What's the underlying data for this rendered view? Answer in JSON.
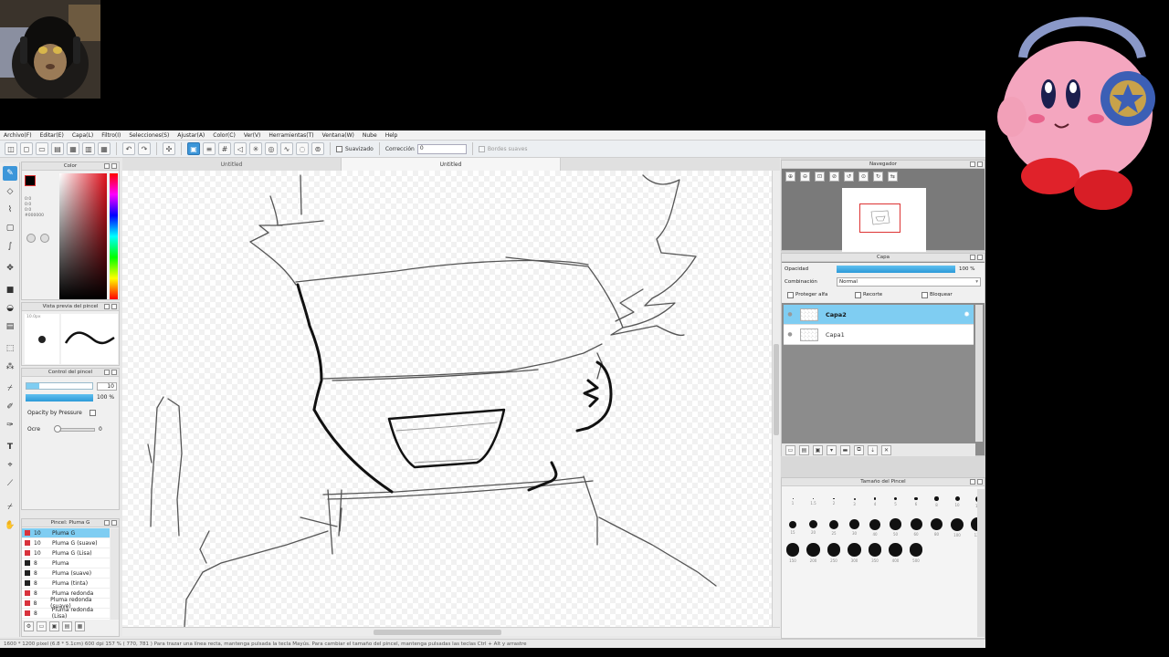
{
  "menu": [
    "Archivo(F)",
    "Editar(E)",
    "Capa(L)",
    "Filtro(I)",
    "Selecciones(S)",
    "Ajustar(A)",
    "Color(C)",
    "Ver(V)",
    "Herramientas(T)",
    "Ventana(W)",
    "Nube",
    "Help"
  ],
  "toolbar": {
    "smooth_label": "Suavizado",
    "correction_label": "Corrección",
    "correction_value": "0",
    "smooth_lines_label": "Bordes suaves"
  },
  "tabs": [
    "Untitled",
    "Untitled"
  ],
  "color_panel": {
    "title": "Color",
    "hex_value": "#000000",
    "rgb_values": [
      "0:0",
      "0:0",
      "0:0"
    ],
    "accent": "#3c96d9"
  },
  "brush_preview": {
    "title": "Vista previa del pincel",
    "size_text": "10.0px"
  },
  "brush_control": {
    "title": "Control del pincel",
    "size_value": "10",
    "opacity_value": "100 %",
    "opacity_pressure_label": "Opacity by Pressure",
    "blur_label": "Ocre",
    "blur_value": "0"
  },
  "brush_list": {
    "title": "Pincel: Pluma G",
    "items": [
      {
        "size": "10",
        "name": "Pluma G",
        "color": "#d8323c",
        "selected": true
      },
      {
        "size": "10",
        "name": "Pluma G (suave)",
        "color": "#d8323c"
      },
      {
        "size": "10",
        "name": "Pluma G (Lisa)",
        "color": "#d8323c"
      },
      {
        "size": "8",
        "name": "Pluma",
        "color": "#222222"
      },
      {
        "size": "8",
        "name": "Pluma (suave)",
        "color": "#222222"
      },
      {
        "size": "8",
        "name": "Pluma (tinta)",
        "color": "#222222"
      },
      {
        "size": "8",
        "name": "Pluma redonda",
        "color": "#d8323c"
      },
      {
        "size": "8",
        "name": "Pluma redonda (suave)",
        "color": "#d8323c"
      },
      {
        "size": "8",
        "name": "Pluma redonda (Lisa)",
        "color": "#d8323c"
      }
    ]
  },
  "navigator": {
    "title": "Navegador"
  },
  "layer_panel": {
    "title": "Capa",
    "opacity_label": "Opacidad",
    "opacity_value": "100 %",
    "blend_label": "Combinación",
    "blend_value": "Normal",
    "protect_alpha": "Proteger alfa",
    "clipping": "Recorte",
    "lock": "Bloquear",
    "layers": [
      {
        "name": "Capa2",
        "selected": true
      },
      {
        "name": "Capa1",
        "selected": false
      }
    ]
  },
  "brush_size_panel": {
    "title": "Tamaño del Pincel",
    "row1": [
      "1",
      "1.5",
      "2",
      "3",
      "4",
      "5",
      "6",
      "8",
      "10",
      "12"
    ],
    "row2": [
      "15",
      "20",
      "25",
      "30",
      "40",
      "50",
      "60",
      "80",
      "100",
      "120"
    ],
    "row3": [
      "150",
      "200",
      "250",
      "300",
      "350",
      "400",
      "500"
    ]
  },
  "status_text": "1600 * 1200 pixel   (6.8 * 5.1cm)   600 dpi   157 %   ( 770, 781 )   Para trazar una línea recta, mantenga pulsada la tecla Mayús. Para cambiar el tamaño del pincel, mantenga pulsadas las teclas Ctrl + Alt y arrastre",
  "colors": {
    "selection": "#7fcdf2",
    "accent": "#3c96d9",
    "brush_red": "#d8323c"
  }
}
